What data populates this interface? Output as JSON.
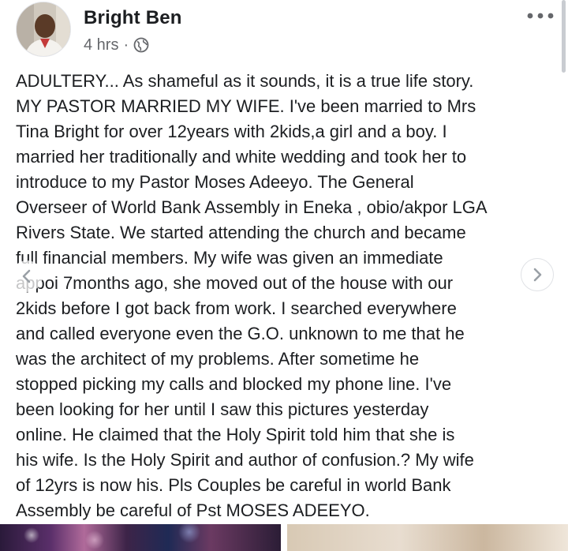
{
  "post": {
    "author": "Bright Ben",
    "timestamp": "4 hrs",
    "separator": "·",
    "privacy_icon": "globe-icon",
    "more_icon": "more-options-icon",
    "body_lines": [
      "ADULTERY... As shameful as it sounds, it is a true life story.",
      "MY PASTOR MARRIED MY WIFE. I've been married to Mrs",
      "Tina Bright for over 12years with 2kids,a girl and a boy. I",
      "married her traditionally and white wedding and took her to",
      "introduce to my Pastor Moses Adeeyo. The General",
      "Overseer of World Bank Assembly in Eneka , obio/akpor LGA",
      "Rivers State. We started attending the church and became",
      "full financial members. My wife was given an immediate",
      "appoi 7months ago, she moved out of the house with our",
      "2kids before I got back from work. I searched everywhere",
      "and called everyone even the G.O. unknown to me that he",
      "was the architect of my problems. After sometime he",
      "stopped picking my calls and blocked my phone line. I've",
      "been looking for her until I saw this pictures yesterday",
      "online. He claimed that the Holy Spirit told him that she is",
      "his wife. Is the Holy Spirit and author of confusion.? My wife",
      "of 12yrs is now his. Pls Couples be careful in world Bank",
      "Assembly be careful of Pst MOSES ADEEYO."
    ]
  },
  "carousel": {
    "prev_icon": "chevron-left-icon",
    "next_icon": "chevron-right-icon"
  },
  "colors": {
    "text": "#1c1e21",
    "meta": "#65676b",
    "background": "#ffffff"
  }
}
